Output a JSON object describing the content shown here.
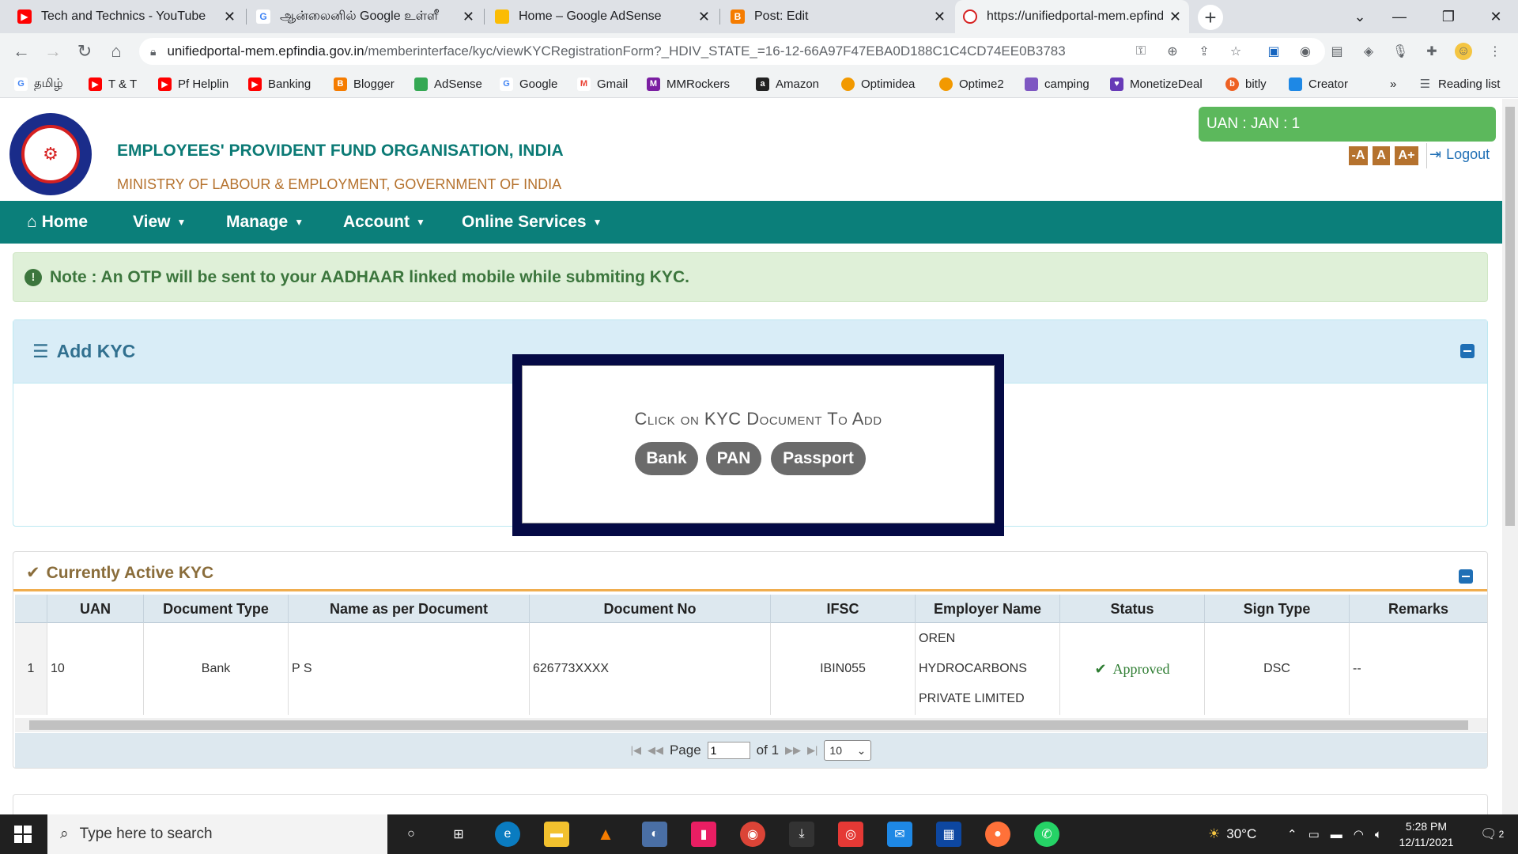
{
  "browser": {
    "tabs": [
      {
        "title": "Tech and Technics - YouTube",
        "favicon": "youtube-icon",
        "color": "#ff0000"
      },
      {
        "title": "ஆன்லைனில் Google உள்ளீ",
        "favicon": "google-icon",
        "color": "#4285f4"
      },
      {
        "title": "Home – Google AdSense",
        "favicon": "adsense-icon",
        "color": "#fbbc04"
      },
      {
        "title": "Post: Edit",
        "favicon": "blogger-icon",
        "color": "#f57c00"
      },
      {
        "title": "https://unifiedportal-mem.epfind",
        "favicon": "epfo-icon",
        "color": "#d62020"
      }
    ],
    "url_host": "unifiedportal-mem.epfindia.gov.in",
    "url_path": "/memberinterface/kyc/viewKYCRegistrationForm?_HDIV_STATE_=16-12-66A97F47EBA0D188C1C4CD74EE0B3783",
    "bookmarks": [
      {
        "label": "தமிழ்",
        "icon": "google-icon",
        "color": "#4285f4"
      },
      {
        "label": "T & T",
        "icon": "youtube-icon",
        "color": "#ff0000"
      },
      {
        "label": "Pf Helplin",
        "icon": "youtube-icon",
        "color": "#ff0000"
      },
      {
        "label": "Banking",
        "icon": "youtube-icon",
        "color": "#ff0000"
      },
      {
        "label": "Blogger",
        "icon": "blogger-icon",
        "color": "#f57c00"
      },
      {
        "label": "AdSense",
        "icon": "adsense-icon",
        "color": "#34a853"
      },
      {
        "label": "Google",
        "icon": "google-icon",
        "color": "#4285f4"
      },
      {
        "label": "Gmail",
        "icon": "gmail-icon",
        "color": "#ea4335"
      },
      {
        "label": "MMRockers",
        "icon": "mmrockers-icon",
        "color": "#7b1fa2"
      },
      {
        "label": "Amazon",
        "icon": "amazon-icon",
        "color": "#222222"
      },
      {
        "label": "Optimidea",
        "icon": "optimidea-icon",
        "color": "#f29900"
      },
      {
        "label": "Optime2",
        "icon": "optime2-icon",
        "color": "#f29900"
      },
      {
        "label": "camping",
        "icon": "camping-icon",
        "color": "#7e57c2"
      },
      {
        "label": "MonetizeDeal",
        "icon": "monetizedeal-icon",
        "color": "#673ab7"
      },
      {
        "label": "bitly",
        "icon": "bitly-icon",
        "color": "#ee6123"
      },
      {
        "label": "Creator",
        "icon": "creator-icon",
        "color": "#1e88e5"
      }
    ],
    "more_bookmarks": "»",
    "reading_list": "Reading list"
  },
  "header": {
    "org_name": "EMPLOYEES' PROVIDENT FUND ORGANISATION, INDIA",
    "ministry": "MINISTRY OF LABOUR & EMPLOYMENT, GOVERNMENT OF INDIA",
    "uan_text": "UAN : JAN : 1",
    "font_small": "-A",
    "font_normal": "A",
    "font_large": "A+",
    "logout": "Logout"
  },
  "nav": {
    "home": "Home",
    "view": "View",
    "manage": "Manage",
    "account": "Account",
    "online_services": "Online Services"
  },
  "note": {
    "text": "Note : An OTP will be sent to your AADHAAR linked mobile while submiting KYC."
  },
  "add_kyc": {
    "title": "Add KYC",
    "caption": "Click on KYC Document To Add",
    "buttons": {
      "bank": "Bank",
      "pan": "PAN",
      "passport": "Passport"
    }
  },
  "active_kyc": {
    "title": "Currently Active KYC",
    "columns": [
      "UAN",
      "Document Type",
      "Name as per Document",
      "Document No",
      "IFSC",
      "Employer Name",
      "Status",
      "Sign Type",
      "Remarks"
    ],
    "rows": [
      {
        "index": "1",
        "uan": "10",
        "document_type": "Bank",
        "name": "P S",
        "document_no": "626773XXXX",
        "ifsc": "IBIN055",
        "employer_line1": "OREN",
        "employer_line2": "HYDROCARBONS",
        "employer_line3": "PRIVATE LIMITED",
        "status": "Approved",
        "sign_type": "DSC",
        "remarks": "--"
      }
    ],
    "pager": {
      "page_label": "Page",
      "page_value": "1",
      "of_label": "of 1",
      "page_size": "10"
    }
  },
  "taskbar": {
    "search_placeholder": "Type here to search",
    "weather": "30°C",
    "time": "5:28 PM",
    "date": "12/11/2021",
    "notifications": "2"
  },
  "colors": {
    "teal": "#0b7f7a",
    "note_green": "#3c763d",
    "approved_green": "#2e7d32",
    "kyc_frame": "#050a45"
  }
}
